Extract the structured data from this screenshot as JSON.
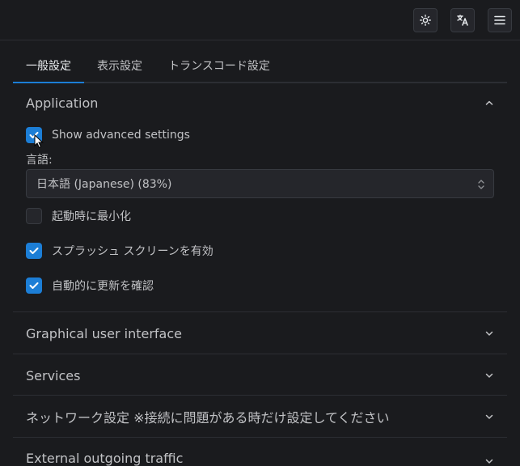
{
  "header": {
    "theme_icon": "sun-icon",
    "language_icon": "translate-icon",
    "menu_icon": "hamburger-menu-icon"
  },
  "tabs": [
    {
      "label": "一般設定",
      "active": true
    },
    {
      "label": "表示設定",
      "active": false
    },
    {
      "label": "トランスコード設定",
      "active": false
    }
  ],
  "sections": {
    "application": {
      "title": "Application",
      "show_advanced": {
        "label": "Show advanced settings",
        "checked": true
      },
      "language": {
        "label": "言語:",
        "value": "日本語 (Japanese) (83%)"
      },
      "minimize": {
        "label": "起動時に最小化",
        "checked": false
      },
      "splash": {
        "label": "スプラッシュ スクリーンを有効",
        "checked": true
      },
      "autoupdate": {
        "label": "自動的に更新を確認",
        "checked": true
      }
    },
    "gui": {
      "title": "Graphical user interface"
    },
    "services": {
      "title": "Services"
    },
    "network": {
      "title": "ネットワーク設定 ※接続に問題がある時だけ設定してください"
    },
    "external": {
      "title": "External outgoing traffic"
    }
  },
  "colors": {
    "accent": "#1c7ed6",
    "background": "#1a1b1e",
    "border": "#2c2e33"
  }
}
